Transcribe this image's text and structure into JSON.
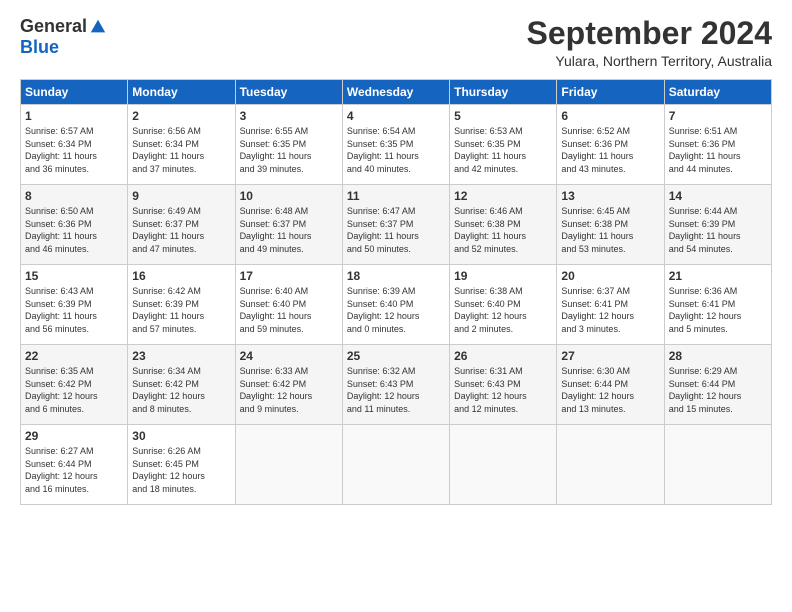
{
  "logo": {
    "general": "General",
    "blue": "Blue"
  },
  "title": "September 2024",
  "location": "Yulara, Northern Territory, Australia",
  "headers": [
    "Sunday",
    "Monday",
    "Tuesday",
    "Wednesday",
    "Thursday",
    "Friday",
    "Saturday"
  ],
  "weeks": [
    [
      {
        "day": "1",
        "sunrise": "6:57 AM",
        "sunset": "6:34 PM",
        "daylight": "11 hours and 36 minutes."
      },
      {
        "day": "2",
        "sunrise": "6:56 AM",
        "sunset": "6:34 PM",
        "daylight": "11 hours and 37 minutes."
      },
      {
        "day": "3",
        "sunrise": "6:55 AM",
        "sunset": "6:35 PM",
        "daylight": "11 hours and 39 minutes."
      },
      {
        "day": "4",
        "sunrise": "6:54 AM",
        "sunset": "6:35 PM",
        "daylight": "11 hours and 40 minutes."
      },
      {
        "day": "5",
        "sunrise": "6:53 AM",
        "sunset": "6:35 PM",
        "daylight": "11 hours and 42 minutes."
      },
      {
        "day": "6",
        "sunrise": "6:52 AM",
        "sunset": "6:36 PM",
        "daylight": "11 hours and 43 minutes."
      },
      {
        "day": "7",
        "sunrise": "6:51 AM",
        "sunset": "6:36 PM",
        "daylight": "11 hours and 44 minutes."
      }
    ],
    [
      {
        "day": "8",
        "sunrise": "6:50 AM",
        "sunset": "6:36 PM",
        "daylight": "11 hours and 46 minutes."
      },
      {
        "day": "9",
        "sunrise": "6:49 AM",
        "sunset": "6:37 PM",
        "daylight": "11 hours and 47 minutes."
      },
      {
        "day": "10",
        "sunrise": "6:48 AM",
        "sunset": "6:37 PM",
        "daylight": "11 hours and 49 minutes."
      },
      {
        "day": "11",
        "sunrise": "6:47 AM",
        "sunset": "6:37 PM",
        "daylight": "11 hours and 50 minutes."
      },
      {
        "day": "12",
        "sunrise": "6:46 AM",
        "sunset": "6:38 PM",
        "daylight": "11 hours and 52 minutes."
      },
      {
        "day": "13",
        "sunrise": "6:45 AM",
        "sunset": "6:38 PM",
        "daylight": "11 hours and 53 minutes."
      },
      {
        "day": "14",
        "sunrise": "6:44 AM",
        "sunset": "6:39 PM",
        "daylight": "11 hours and 54 minutes."
      }
    ],
    [
      {
        "day": "15",
        "sunrise": "6:43 AM",
        "sunset": "6:39 PM",
        "daylight": "11 hours and 56 minutes."
      },
      {
        "day": "16",
        "sunrise": "6:42 AM",
        "sunset": "6:39 PM",
        "daylight": "11 hours and 57 minutes."
      },
      {
        "day": "17",
        "sunrise": "6:40 AM",
        "sunset": "6:40 PM",
        "daylight": "11 hours and 59 minutes."
      },
      {
        "day": "18",
        "sunrise": "6:39 AM",
        "sunset": "6:40 PM",
        "daylight": "12 hours and 0 minutes."
      },
      {
        "day": "19",
        "sunrise": "6:38 AM",
        "sunset": "6:40 PM",
        "daylight": "12 hours and 2 minutes."
      },
      {
        "day": "20",
        "sunrise": "6:37 AM",
        "sunset": "6:41 PM",
        "daylight": "12 hours and 3 minutes."
      },
      {
        "day": "21",
        "sunrise": "6:36 AM",
        "sunset": "6:41 PM",
        "daylight": "12 hours and 5 minutes."
      }
    ],
    [
      {
        "day": "22",
        "sunrise": "6:35 AM",
        "sunset": "6:42 PM",
        "daylight": "12 hours and 6 minutes."
      },
      {
        "day": "23",
        "sunrise": "6:34 AM",
        "sunset": "6:42 PM",
        "daylight": "12 hours and 8 minutes."
      },
      {
        "day": "24",
        "sunrise": "6:33 AM",
        "sunset": "6:42 PM",
        "daylight": "12 hours and 9 minutes."
      },
      {
        "day": "25",
        "sunrise": "6:32 AM",
        "sunset": "6:43 PM",
        "daylight": "12 hours and 11 minutes."
      },
      {
        "day": "26",
        "sunrise": "6:31 AM",
        "sunset": "6:43 PM",
        "daylight": "12 hours and 12 minutes."
      },
      {
        "day": "27",
        "sunrise": "6:30 AM",
        "sunset": "6:44 PM",
        "daylight": "12 hours and 13 minutes."
      },
      {
        "day": "28",
        "sunrise": "6:29 AM",
        "sunset": "6:44 PM",
        "daylight": "12 hours and 15 minutes."
      }
    ],
    [
      {
        "day": "29",
        "sunrise": "6:27 AM",
        "sunset": "6:44 PM",
        "daylight": "12 hours and 16 minutes."
      },
      {
        "day": "30",
        "sunrise": "6:26 AM",
        "sunset": "6:45 PM",
        "daylight": "12 hours and 18 minutes."
      },
      null,
      null,
      null,
      null,
      null
    ]
  ]
}
